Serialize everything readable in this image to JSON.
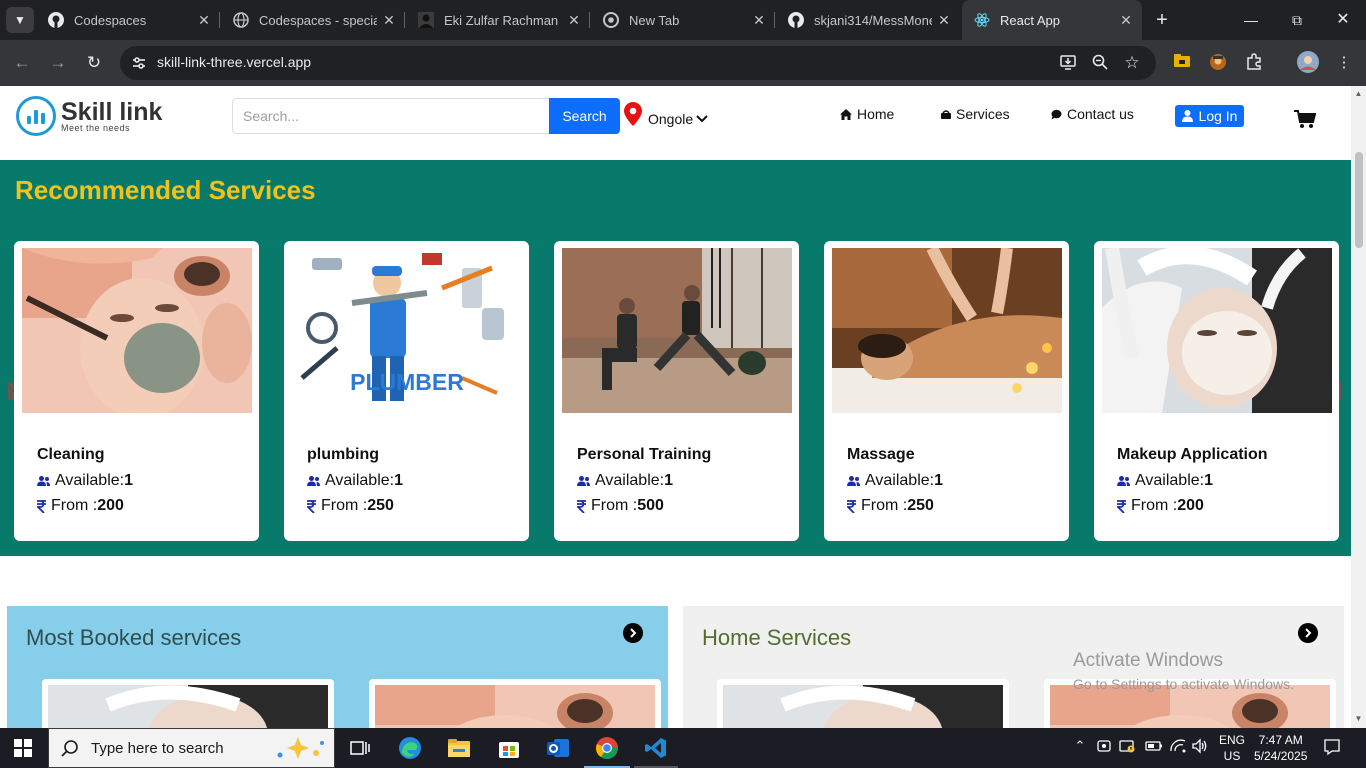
{
  "browser": {
    "tabs": [
      {
        "title": "Codespaces",
        "favicon": "github-icon"
      },
      {
        "title": "Codespaces - special",
        "favicon": "globe-icon"
      },
      {
        "title": "Eki Zulfar Rachman - ",
        "favicon": "avatar-icon"
      },
      {
        "title": "New Tab",
        "favicon": "chrome-icon"
      },
      {
        "title": "skjani314/MessMone",
        "favicon": "github-icon"
      },
      {
        "title": "React App",
        "favicon": "react-icon",
        "active": true
      }
    ],
    "url": "skill-link-three.vercel.app"
  },
  "site": {
    "logo_name": "Skill link",
    "logo_tagline": "Meet the needs",
    "search_placeholder": "Search...",
    "search_button": "Search",
    "location": "Ongole",
    "nav": {
      "home": "Home",
      "services": "Services",
      "contact": "Contact us"
    },
    "login": "Log In",
    "colors": {
      "primary": "#0d6efd",
      "teal": "#077a6c",
      "title_yellow": "#f2c21b",
      "sky": "#87ceeb"
    }
  },
  "recommended": {
    "title": "Recommended Services",
    "available_label": "Available:",
    "from_label": "From :",
    "cards": [
      {
        "name": "Cleaning",
        "available": "1",
        "price": "200",
        "image": "facial-mask-photo"
      },
      {
        "name": "plumbing",
        "available": "1",
        "price": "250",
        "image": "plumber-illustration",
        "image_text": "PLUMBER"
      },
      {
        "name": "Personal Training",
        "available": "1",
        "price": "500",
        "image": "gym-training-photo"
      },
      {
        "name": "Massage",
        "available": "1",
        "price": "250",
        "image": "massage-photo"
      },
      {
        "name": "Makeup Application",
        "available": "1",
        "price": "200",
        "image": "facial-treatment-photo"
      }
    ]
  },
  "sections": {
    "most_booked": "Most Booked services",
    "home_services": "Home Services"
  },
  "watermark": {
    "line1": "Activate Windows",
    "line2": "Go to Settings to activate Windows."
  },
  "taskbar": {
    "search_placeholder": "Type here to search",
    "lang_top": "ENG",
    "lang_bottom": "US",
    "time": "7:47 AM",
    "date": "5/24/2025"
  }
}
